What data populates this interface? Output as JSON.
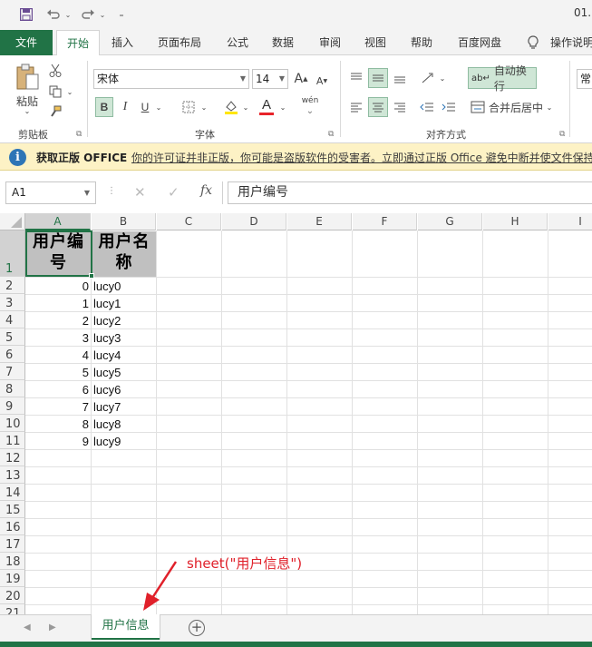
{
  "titlebar": {
    "doc_title": "01.",
    "save_icon": "save-icon",
    "undo_icon": "undo-icon",
    "redo_icon": "redo-icon",
    "customize_icon": "customize-quick-access-icon"
  },
  "tabs": {
    "file": "文件",
    "home": "开始",
    "insert": "插入",
    "page_layout": "页面布局",
    "formulas": "公式",
    "data": "数据",
    "review": "审阅",
    "view": "视图",
    "help": "帮助",
    "baidu": "百度网盘",
    "tell_me": "操作说明"
  },
  "ribbon": {
    "clipboard": {
      "paste": "粘贴",
      "label": "剪贴板"
    },
    "font": {
      "name": "宋体",
      "size": "14",
      "label": "字体",
      "bold": "B",
      "italic": "I",
      "underline": "U",
      "grow": "A",
      "shrink": "A",
      "phonetic": "wén",
      "font_color_glyph": "A",
      "font_color": "#e8232a",
      "highlight_color": "#ffe600"
    },
    "alignment": {
      "wrap_text": "自动换行",
      "merge_center": "合并后居中",
      "label": "对齐方式"
    },
    "number": {
      "format": "常"
    }
  },
  "infobar": {
    "title": "获取正版 OFFICE",
    "message": "你的许可证并非正版，你可能是盗版软件的受害者。立即通过正版 Office 避免中断并使文件保持"
  },
  "formula_bar": {
    "name_box": "A1",
    "fx": "fx",
    "content": "用户编号"
  },
  "grid": {
    "columns": [
      "A",
      "B",
      "C",
      "D",
      "E",
      "F",
      "G",
      "H",
      "I"
    ],
    "rows": [
      "1",
      "2",
      "3",
      "4",
      "5",
      "6",
      "7",
      "8",
      "9",
      "10",
      "11",
      "12",
      "13",
      "14",
      "15",
      "16",
      "17",
      "18",
      "19",
      "20",
      "21"
    ],
    "header_row": {
      "a_line1": "用户编",
      "a_line2": "号",
      "b_line1": "用户名",
      "b_line2": "称"
    },
    "ids": [
      "0",
      "1",
      "2",
      "3",
      "4",
      "5",
      "6",
      "7",
      "8",
      "9"
    ],
    "names": [
      "lucy0",
      "lucy1",
      "lucy2",
      "lucy3",
      "lucy4",
      "lucy5",
      "lucy6",
      "lucy7",
      "lucy8",
      "lucy9"
    ],
    "header_fill": "#c0c0c0"
  },
  "annotation": {
    "text": "sheet(\"用户信息\")",
    "color": "#e0202a"
  },
  "sheetbar": {
    "active_sheet": "用户信息",
    "add": "+",
    "accent": "#217346"
  }
}
